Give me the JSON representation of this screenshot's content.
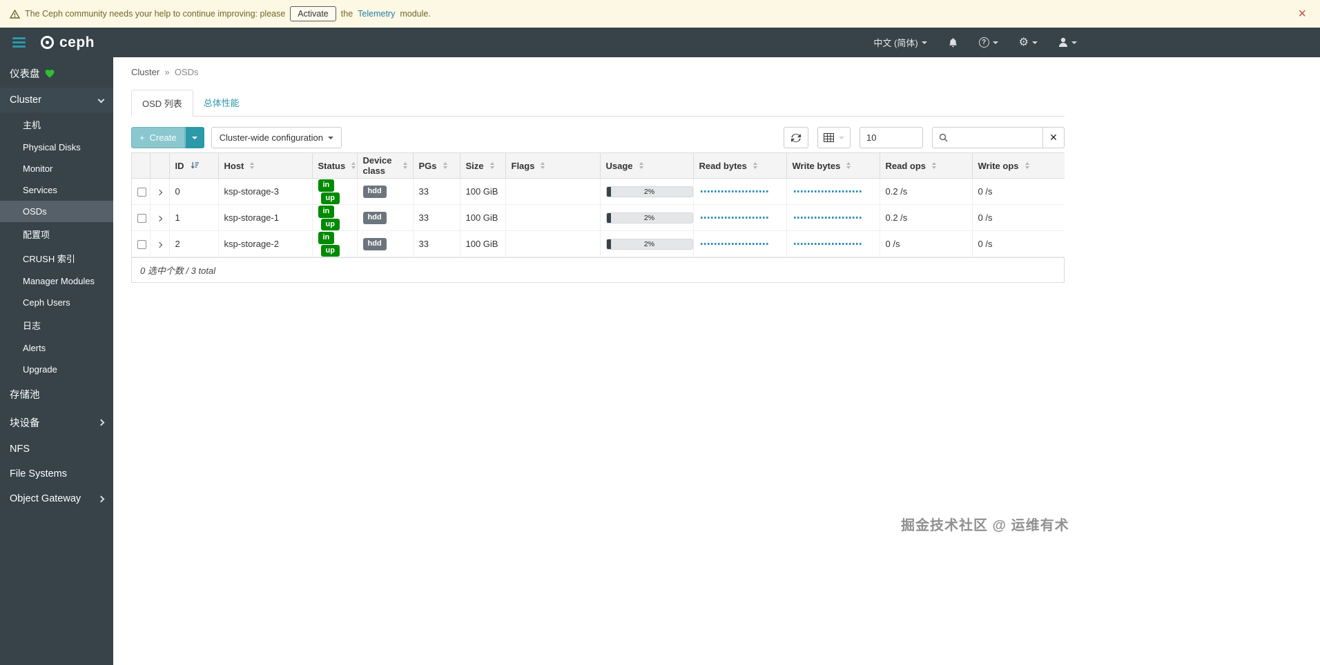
{
  "colors": {
    "accent_teal": "#2b99a8",
    "navbar_bg": "#374249",
    "sidebar_active_bg": "#566069",
    "success_green": "#008a00",
    "badge_gray": "#6c757d",
    "banner_bg": "#fcf8e3",
    "sparkline_blue": "#2b8cbe",
    "usage_fill": "#374249"
  },
  "banner": {
    "text_intro": "The Ceph community needs your help to continue improving: please",
    "activate_button": "Activate",
    "text_the": "the",
    "telemetry_link": "Telemetry",
    "text_module": "module.",
    "close": "×"
  },
  "navbar": {
    "brand": "ceph",
    "language": "中文 (简体)",
    "help_glyph": "?",
    "gear_glyph": "⚙"
  },
  "sidebar": {
    "dashboard": "仪表盘",
    "cluster": "Cluster",
    "cluster_children": [
      "主机",
      "Physical Disks",
      "Monitor",
      "Services",
      "OSDs",
      "配置项",
      "CRUSH 索引",
      "Manager Modules",
      "Ceph Users",
      "日志",
      "Alerts",
      "Upgrade"
    ],
    "pools": "存储池",
    "block": "块设备",
    "nfs": "NFS",
    "file_systems": "File Systems",
    "object_gateway": "Object Gateway"
  },
  "breadcrumb": {
    "parent": "Cluster",
    "separator": "»",
    "current": "OSDs"
  },
  "tabs": {
    "osd_list": "OSD 列表",
    "overall_performance": "总体性能"
  },
  "toolbar": {
    "create_icon": "+",
    "create_label": "Create",
    "cluster_wide_label": "Cluster-wide configuration",
    "page_size": "10"
  },
  "table": {
    "columns": [
      "ID",
      "Host",
      "Status",
      "Device class",
      "PGs",
      "Size",
      "Flags",
      "Usage",
      "Read bytes",
      "Write bytes",
      "Read ops",
      "Write ops"
    ],
    "rows": [
      {
        "id": "0",
        "host": "ksp-storage-3",
        "status": [
          "in",
          "up"
        ],
        "device_class": "hdd",
        "pgs": "33",
        "size": "100 GiB",
        "flags": "",
        "usage": "2%",
        "read_ops": "0.2 /s",
        "write_ops": "0 /s"
      },
      {
        "id": "1",
        "host": "ksp-storage-1",
        "status": [
          "in",
          "up"
        ],
        "device_class": "hdd",
        "pgs": "33",
        "size": "100 GiB",
        "flags": "",
        "usage": "2%",
        "read_ops": "0.2 /s",
        "write_ops": "0 /s"
      },
      {
        "id": "2",
        "host": "ksp-storage-2",
        "status": [
          "in",
          "up"
        ],
        "device_class": "hdd",
        "pgs": "33",
        "size": "100 GiB",
        "flags": "",
        "usage": "2%",
        "read_ops": "0 /s",
        "write_ops": "0 /s"
      }
    ],
    "footer": "0 选中个数 / 3 total"
  },
  "watermark": "掘金技术社区 @ 运维有术"
}
